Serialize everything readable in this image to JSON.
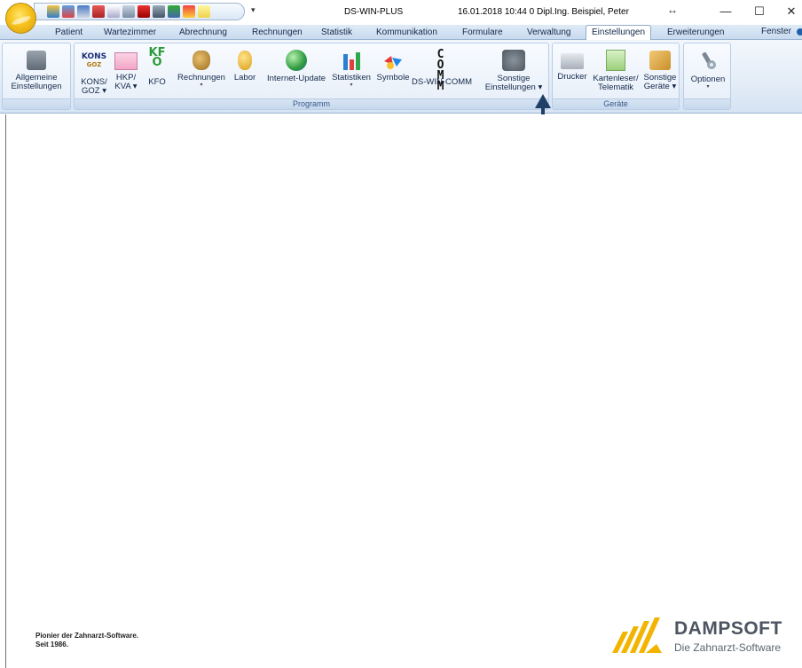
{
  "title_bar": {
    "app_title": "DS-WIN-PLUS",
    "status": "16.01.2018  10:44  0  Dipl.Ing.  Beispiel, Peter",
    "qat_dropdown": "▾",
    "resize_glyph": "↔",
    "minimize": "—",
    "maximize": "☐",
    "close": "✕"
  },
  "tabs": [
    {
      "label": "Patient"
    },
    {
      "label": "Wartezimmer"
    },
    {
      "label": "Abrechnung"
    },
    {
      "label": "Rechnungen"
    },
    {
      "label": "Statistik"
    },
    {
      "label": "Kommunikation"
    },
    {
      "label": "Formulare"
    },
    {
      "label": "Verwaltung"
    },
    {
      "label": "Einstellungen",
      "active": true
    },
    {
      "label": "Erweiterungen"
    }
  ],
  "fenster_label": "Fenster",
  "ribbon": {
    "allgemeine": {
      "line1": "Allgemeine",
      "line2": "Einstellungen"
    },
    "programm": {
      "label": "Programm",
      "kons_icon_top": "KONS",
      "kons_icon_bottom": "GOZ",
      "kfo_icon_top": "KF",
      "kfo_icon_bottom": "O",
      "comm_icon_top": "C O",
      "comm_icon_bottom": "M M",
      "items": [
        {
          "line1": "KONS/",
          "line2": "GOZ ▾"
        },
        {
          "line1": "HKP/",
          "line2": "KVA ▾"
        },
        {
          "line1": "KFO",
          "line2": ""
        },
        {
          "line1": "Rechnungen",
          "line2": "▾"
        },
        {
          "line1": "Labor",
          "line2": ""
        },
        {
          "line1": "Internet-Update",
          "line2": ""
        },
        {
          "line1": "Statistiken",
          "line2": "▾"
        },
        {
          "line1": "Symbole",
          "line2": ""
        },
        {
          "line1": "DS-WIN-COMM",
          "line2": ""
        },
        {
          "line1": "Sonstige",
          "line2": "Einstellungen ▾"
        }
      ]
    },
    "geraete": {
      "label": "Geräte",
      "items": [
        {
          "line1": "Drucker",
          "line2": ""
        },
        {
          "line1": "Kartenleser/",
          "line2": "Telematik"
        },
        {
          "line1": "Sonstige",
          "line2": "Geräte ▾"
        }
      ]
    },
    "optionen": {
      "line1": "Optionen",
      "line2": "▾"
    }
  },
  "footer": {
    "pioneer_line1": "Pionier der Zahnarzt-Software.",
    "pioneer_line2": "Seit 1986.",
    "logo_name": "DAMPSOFT",
    "logo_sub": "Die Zahnarzt-Software"
  },
  "colors": {
    "accent_blue": "#1f3f66",
    "ribbon_bg": "#e3ecf7",
    "logo_yellow": "#f2b400"
  }
}
